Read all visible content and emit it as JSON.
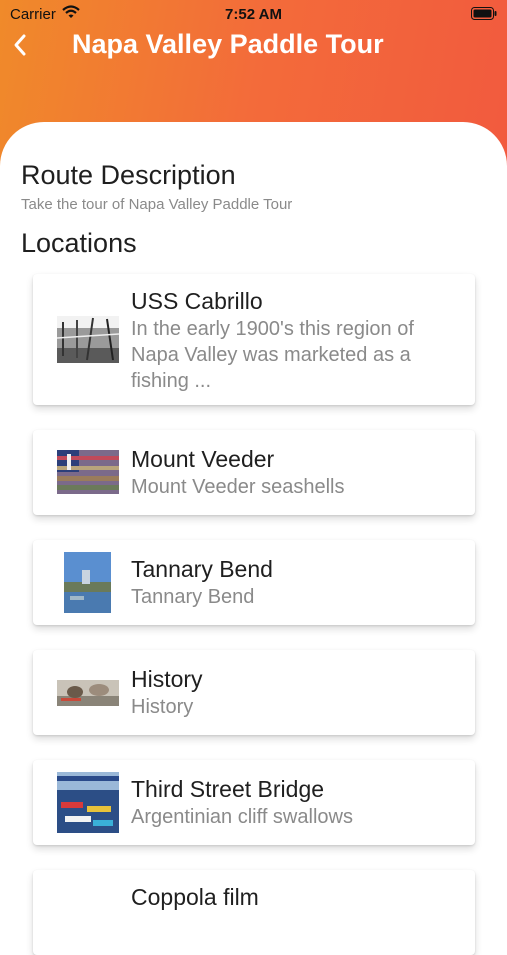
{
  "status_bar": {
    "carrier": "Carrier",
    "time": "7:52 AM"
  },
  "nav": {
    "title": "Napa Valley Paddle Tour",
    "back_icon": "chevron-left-icon"
  },
  "route": {
    "heading": "Route Description",
    "subtitle": "Take the tour of Napa Valley Paddle Tour"
  },
  "locations": {
    "heading": "Locations",
    "items": [
      {
        "title": "USS Cabrillo",
        "description": "In the early 1900's this region of Napa Valley was marketed as a fishing ..."
      },
      {
        "title": "Mount Veeder",
        "description": "Mount Veeder seashells"
      },
      {
        "title": "Tannary Bend",
        "description": "Tannary Bend"
      },
      {
        "title": "History",
        "description": "History"
      },
      {
        "title": "Third Street Bridge",
        "description": "Argentinian cliff swallows"
      },
      {
        "title": "Coppola film",
        "description": ""
      }
    ]
  },
  "colors": {
    "header_start": "#f08a2a",
    "header_end": "#f25a3e",
    "title_text": "#1f1f1f",
    "secondary_text": "#8a8a8a"
  }
}
